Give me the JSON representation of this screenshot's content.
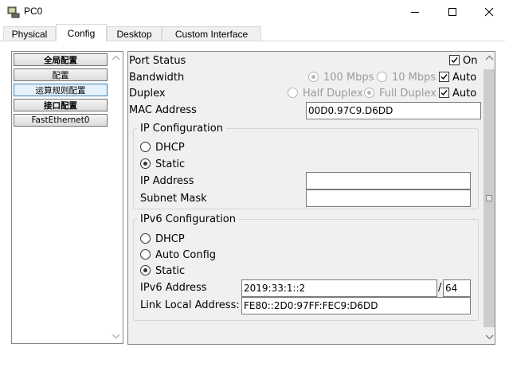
{
  "window": {
    "title": "PC0"
  },
  "tabs": [
    "Physical",
    "Config",
    "Desktop",
    "Custom Interface"
  ],
  "sidebar": {
    "items": [
      "全局配置",
      "配置",
      "运算规则配置",
      "接口配置",
      "FastEthernet0"
    ]
  },
  "port": {
    "status_label": "Port Status",
    "on_label": "On",
    "bandwidth_label": "Bandwidth",
    "bw_100": "100 Mbps",
    "bw_10": "10 Mbps",
    "auto_label": "Auto",
    "duplex_label": "Duplex",
    "half_label": "Half Duplex",
    "full_label": "Full Duplex",
    "mac_label": "MAC Address",
    "mac_value": "00D0.97C9.D6DD"
  },
  "ipv4": {
    "title": "IP Configuration",
    "dhcp_label": "DHCP",
    "static_label": "Static",
    "ip_label": "IP Address",
    "ip_value": "",
    "mask_label": "Subnet Mask",
    "mask_value": ""
  },
  "ipv6": {
    "title": "IPv6 Configuration",
    "dhcp_label": "DHCP",
    "auto_label": "Auto Config",
    "static_label": "Static",
    "addr_label": "IPv6 Address",
    "addr_value": "2019:33:1::2",
    "slash": "/",
    "prefix_value": "64",
    "link_label": "Link Local Address:",
    "link_value": "FE80::2D0:97FF:FEC9:D6DD"
  },
  "colors": {
    "selected_border": "#3c7fb1",
    "panel_bg": "#f0f0f0"
  }
}
